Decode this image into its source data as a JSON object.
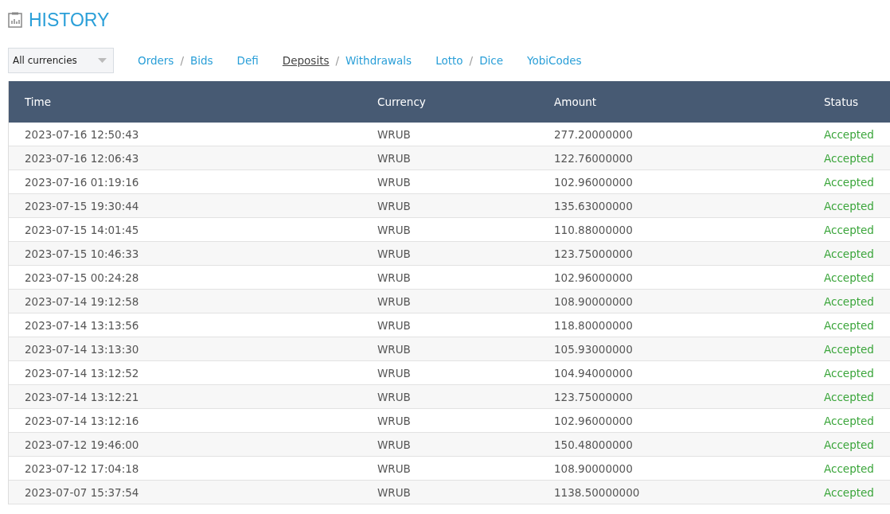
{
  "title": "HISTORY",
  "currency_select": {
    "value": "All currencies"
  },
  "nav": [
    [
      {
        "label": "Orders",
        "selected": false
      },
      {
        "label": "Bids",
        "selected": false
      }
    ],
    [
      {
        "label": "Defi",
        "selected": false
      }
    ],
    [
      {
        "label": "Deposits",
        "selected": true
      },
      {
        "label": "Withdrawals",
        "selected": false
      }
    ],
    [
      {
        "label": "Lotto",
        "selected": false
      },
      {
        "label": "Dice",
        "selected": false
      }
    ],
    [
      {
        "label": "YobiCodes",
        "selected": false
      }
    ]
  ],
  "nav_separator": "/",
  "table": {
    "columns": [
      "Time",
      "Currency",
      "Amount",
      "Status"
    ],
    "rows": [
      [
        "2023-07-16 12:50:43",
        "WRUB",
        "277.20000000",
        "Accepted"
      ],
      [
        "2023-07-16 12:06:43",
        "WRUB",
        "122.76000000",
        "Accepted"
      ],
      [
        "2023-07-16 01:19:16",
        "WRUB",
        "102.96000000",
        "Accepted"
      ],
      [
        "2023-07-15 19:30:44",
        "WRUB",
        "135.63000000",
        "Accepted"
      ],
      [
        "2023-07-15 14:01:45",
        "WRUB",
        "110.88000000",
        "Accepted"
      ],
      [
        "2023-07-15 10:46:33",
        "WRUB",
        "123.75000000",
        "Accepted"
      ],
      [
        "2023-07-15 00:24:28",
        "WRUB",
        "102.96000000",
        "Accepted"
      ],
      [
        "2023-07-14 19:12:58",
        "WRUB",
        "108.90000000",
        "Accepted"
      ],
      [
        "2023-07-14 13:13:56",
        "WRUB",
        "118.80000000",
        "Accepted"
      ],
      [
        "2023-07-14 13:13:30",
        "WRUB",
        "105.93000000",
        "Accepted"
      ],
      [
        "2023-07-14 13:12:52",
        "WRUB",
        "104.94000000",
        "Accepted"
      ],
      [
        "2023-07-14 13:12:21",
        "WRUB",
        "123.75000000",
        "Accepted"
      ],
      [
        "2023-07-14 13:12:16",
        "WRUB",
        "102.96000000",
        "Accepted"
      ],
      [
        "2023-07-12 19:46:00",
        "WRUB",
        "150.48000000",
        "Accepted"
      ],
      [
        "2023-07-12 17:04:18",
        "WRUB",
        "108.90000000",
        "Accepted"
      ],
      [
        "2023-07-07 15:37:54",
        "WRUB",
        "1138.50000000",
        "Accepted"
      ]
    ]
  }
}
